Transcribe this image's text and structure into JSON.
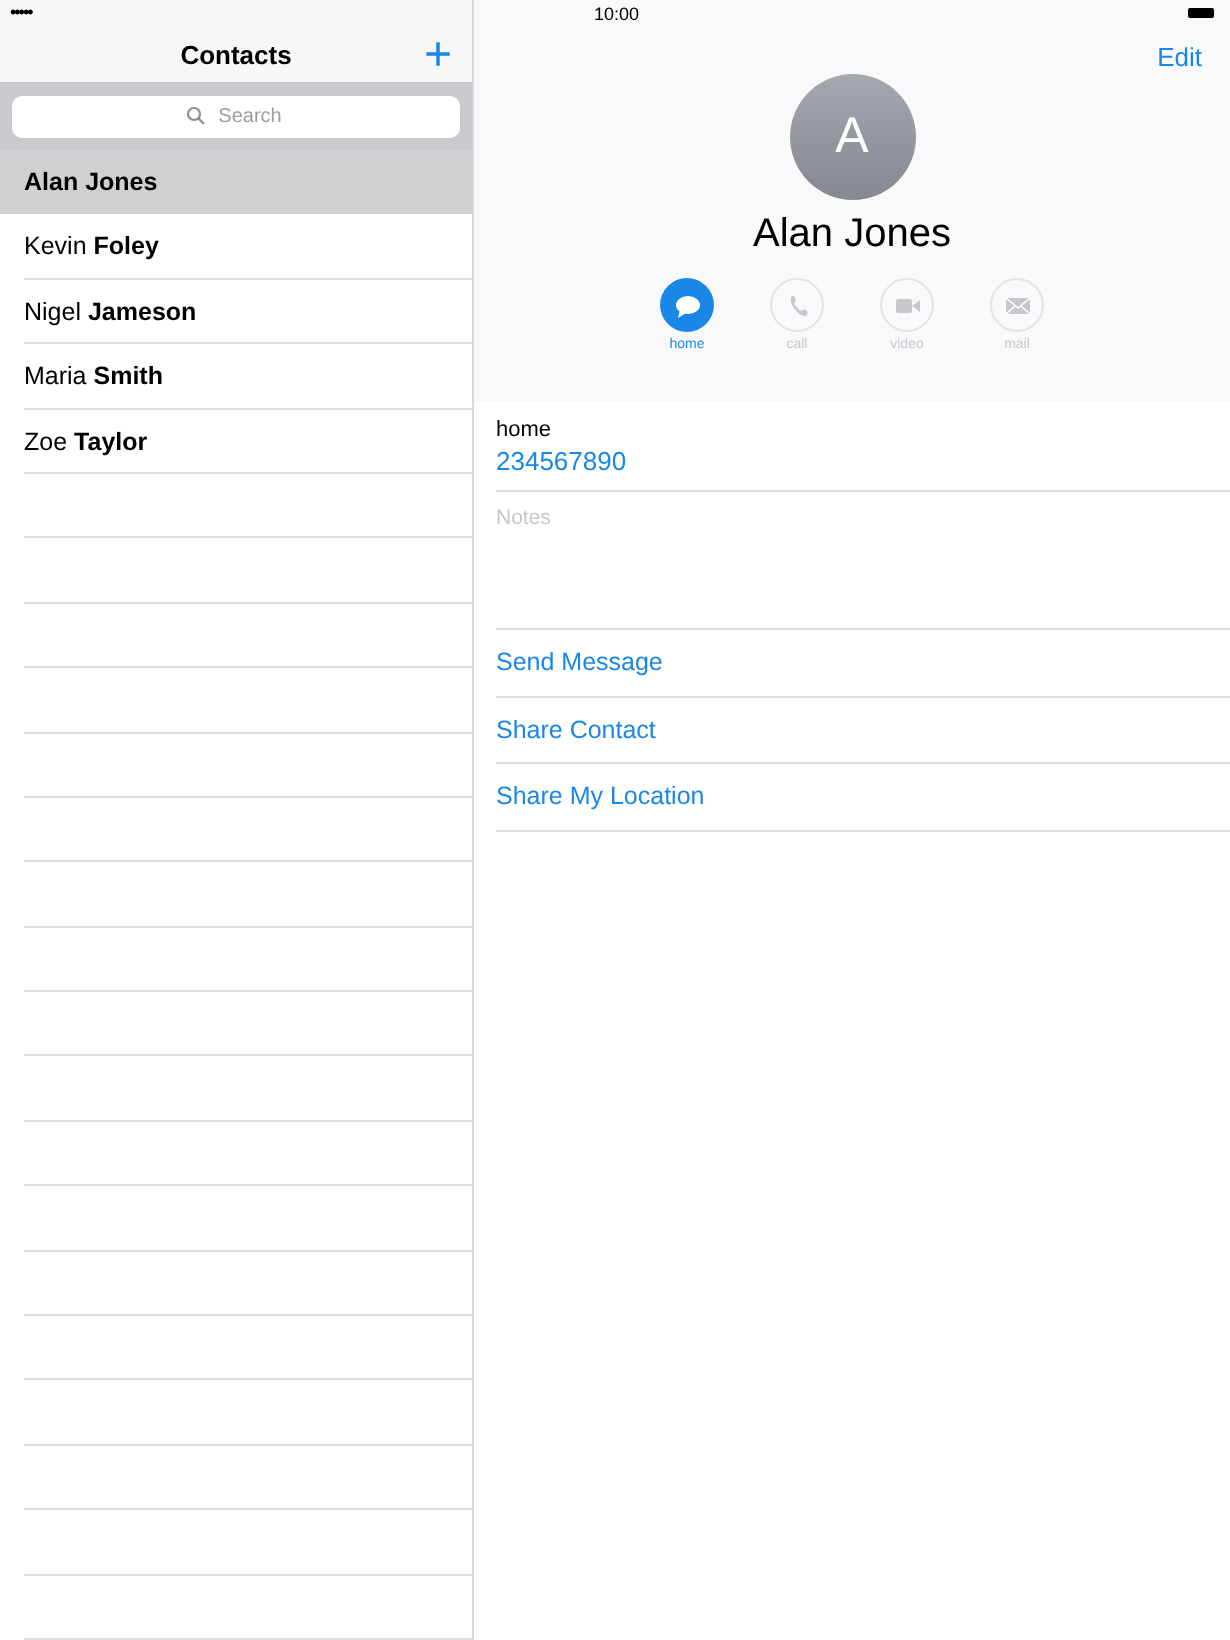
{
  "status_bar": {
    "signal": "•••••",
    "time": "10:00"
  },
  "sidebar": {
    "title": "Contacts",
    "add": "+",
    "search": {
      "placeholder": "Search"
    },
    "contacts": [
      {
        "first": "Alan",
        "last": "Jones",
        "selected": true
      },
      {
        "first": "Kevin",
        "last": "Foley",
        "selected": false
      },
      {
        "first": "Nigel",
        "last": "Jameson",
        "selected": false
      },
      {
        "first": "Maria",
        "last": "Smith",
        "selected": false
      },
      {
        "first": "Zoe",
        "last": "Taylor",
        "selected": false
      }
    ]
  },
  "detail": {
    "edit": "Edit",
    "initial": "A",
    "name": "Alan Jones",
    "actions": [
      {
        "kind": "message",
        "label": "home",
        "disabled": false
      },
      {
        "kind": "call",
        "label": "call",
        "disabled": true
      },
      {
        "kind": "video",
        "label": "video",
        "disabled": true
      },
      {
        "kind": "mail",
        "label": "mail",
        "disabled": true
      }
    ],
    "phone": {
      "label": "home",
      "number": "234567890"
    },
    "notes": {
      "placeholder": "Notes"
    },
    "links": [
      "Send Message",
      "Share Contact",
      "Share My Location"
    ]
  }
}
